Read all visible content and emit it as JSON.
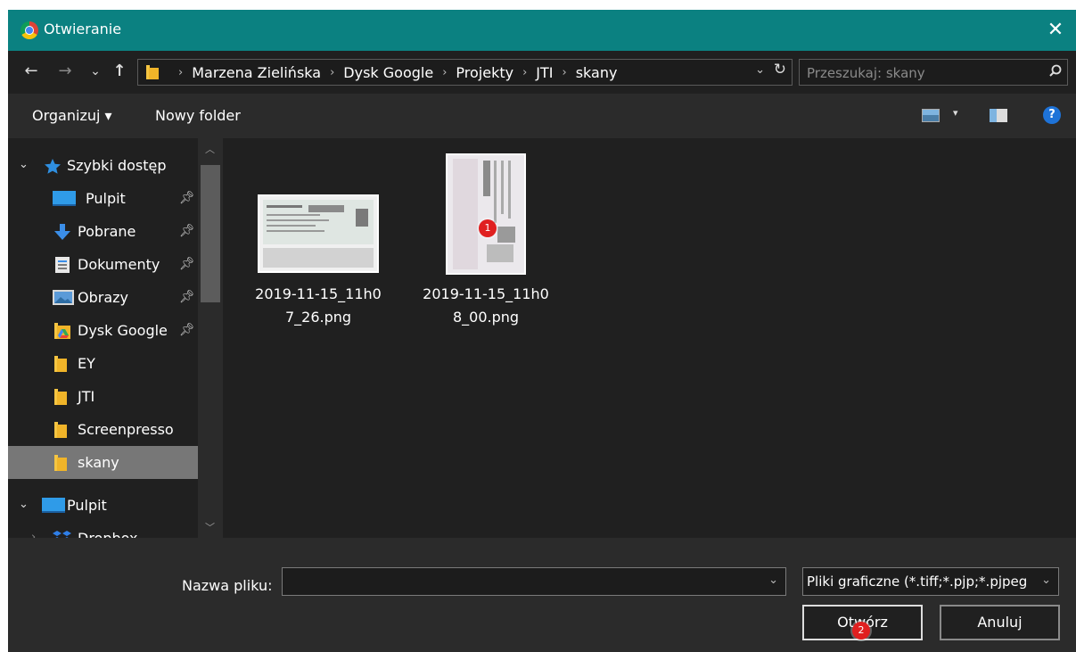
{
  "window": {
    "title": "Otwieranie",
    "close_label": "✕"
  },
  "nav": {
    "back": "←",
    "forward": "→",
    "recent": "⌄",
    "up": "↑",
    "breadcrumbs": [
      "Marzena Zielińska",
      "Dysk Google",
      "Projekty",
      "JTI",
      "skany"
    ],
    "refresh": "↻",
    "search_placeholder": "Przeszukaj: skany"
  },
  "toolbar": {
    "organize": "Organizuj ▾",
    "new_folder": "Nowy folder",
    "help": "?"
  },
  "sidebar": {
    "items": [
      {
        "label": "Szybki dostęp",
        "icon": "star-icon"
      },
      {
        "label": "Pulpit",
        "icon": "desktop-icon",
        "pinned": true
      },
      {
        "label": "Pobrane",
        "icon": "download-icon",
        "pinned": true
      },
      {
        "label": "Dokumenty",
        "icon": "document-icon",
        "pinned": true
      },
      {
        "label": "Obrazy",
        "icon": "pictures-icon",
        "pinned": true
      },
      {
        "label": "Dysk Google",
        "icon": "google-drive-icon",
        "pinned": true
      },
      {
        "label": "EY",
        "icon": "folder-icon"
      },
      {
        "label": "JTI",
        "icon": "folder-icon"
      },
      {
        "label": "Screenpresso",
        "icon": "folder-icon"
      },
      {
        "label": "skany",
        "icon": "folder-icon",
        "selected": true
      },
      {
        "label": "Pulpit",
        "icon": "desktop-icon"
      },
      {
        "label": "Dropbox",
        "icon": "dropbox-icon"
      }
    ]
  },
  "files": [
    {
      "line1": "2019-11-15_11h0",
      "line2": "7_26.png"
    },
    {
      "line1": "2019-11-15_11h0",
      "line2": "8_00.png",
      "badge": "1"
    }
  ],
  "bottom": {
    "filename_label": "Nazwa pliku:",
    "filename_value": "",
    "filter": "Pliki graficzne (*.tiff;*.pjp;*.pjpeg",
    "open_button": "Otwórz",
    "open_badge": "2",
    "cancel_button": "Anuluj"
  },
  "colors": {
    "titlebar": "#0b8181",
    "background": "#202020",
    "toolbar": "#2b2b2b",
    "selected": "#777777",
    "badge": "#e02020"
  }
}
